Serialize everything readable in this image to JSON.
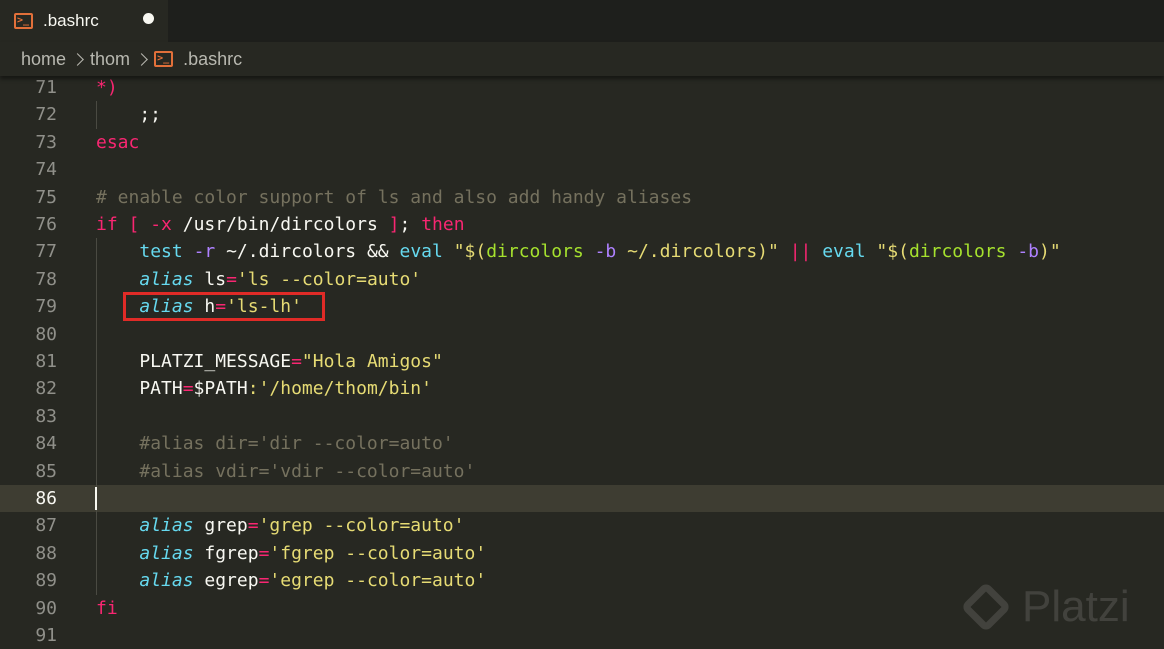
{
  "tab": {
    "title": ".bashrc",
    "modified": true
  },
  "breadcrumb": [
    "home",
    "thom",
    ".bashrc"
  ],
  "editor": {
    "current_line": 86,
    "lines": [
      {
        "n": 71,
        "tokens": [
          [
            "k",
            "*)"
          ]
        ]
      },
      {
        "n": 72,
        "tokens": [
          [
            "w",
            "    ;;"
          ]
        ]
      },
      {
        "n": 73,
        "tokens": [
          [
            "k",
            "esac"
          ]
        ]
      },
      {
        "n": 74,
        "tokens": []
      },
      {
        "n": 75,
        "tokens": [
          [
            "c",
            "# enable color support of ls and also add handy aliases"
          ]
        ]
      },
      {
        "n": 76,
        "tokens": [
          [
            "k",
            "if"
          ],
          [
            "w",
            " "
          ],
          [
            "k",
            "["
          ],
          [
            "w",
            " "
          ],
          [
            "k",
            "-x"
          ],
          [
            "w",
            " /usr/bin/dircolors "
          ],
          [
            "k",
            "]"
          ],
          [
            "w",
            "; "
          ],
          [
            "k",
            "then"
          ]
        ]
      },
      {
        "n": 77,
        "tokens": [
          [
            "w",
            "    "
          ],
          [
            "b",
            "test"
          ],
          [
            "w",
            " "
          ],
          [
            "p",
            "-r"
          ],
          [
            "w",
            " ~/.dircolors && "
          ],
          [
            "b",
            "eval"
          ],
          [
            "w",
            " "
          ],
          [
            "s",
            "\"$("
          ],
          [
            "g",
            "dircolors"
          ],
          [
            "s",
            " "
          ],
          [
            "p",
            "-b"
          ],
          [
            "s",
            " ~/.dircolors)\""
          ],
          [
            "w",
            " "
          ],
          [
            "k",
            "||"
          ],
          [
            "w",
            " "
          ],
          [
            "b",
            "eval"
          ],
          [
            "w",
            " "
          ],
          [
            "s",
            "\"$("
          ],
          [
            "g",
            "dircolors"
          ],
          [
            "s",
            " "
          ],
          [
            "p",
            "-b"
          ],
          [
            "s",
            ")\""
          ]
        ]
      },
      {
        "n": 78,
        "tokens": [
          [
            "w",
            "    "
          ],
          [
            "i",
            "alias"
          ],
          [
            "w",
            " ls"
          ],
          [
            "k",
            "="
          ],
          [
            "s",
            "'ls --color=auto'"
          ]
        ]
      },
      {
        "n": 79,
        "tokens": [
          [
            "w",
            "    "
          ],
          [
            "i",
            "alias"
          ],
          [
            "w",
            " h"
          ],
          [
            "k",
            "="
          ],
          [
            "s",
            "'ls-lh'"
          ]
        ]
      },
      {
        "n": 80,
        "tokens": []
      },
      {
        "n": 81,
        "tokens": [
          [
            "w",
            "    PLATZI_MESSAGE"
          ],
          [
            "k",
            "="
          ],
          [
            "s",
            "\"Hola Amigos\""
          ]
        ]
      },
      {
        "n": 82,
        "tokens": [
          [
            "w",
            "    PATH"
          ],
          [
            "k",
            "="
          ],
          [
            "w",
            "$PATH"
          ],
          [
            "s",
            ":'/home/thom/bin'"
          ]
        ]
      },
      {
        "n": 83,
        "tokens": []
      },
      {
        "n": 84,
        "tokens": [
          [
            "w",
            "    "
          ],
          [
            "c",
            "#alias dir='dir --color=auto'"
          ]
        ]
      },
      {
        "n": 85,
        "tokens": [
          [
            "w",
            "    "
          ],
          [
            "c",
            "#alias vdir='vdir --color=auto'"
          ]
        ]
      },
      {
        "n": 86,
        "tokens": []
      },
      {
        "n": 87,
        "tokens": [
          [
            "w",
            "    "
          ],
          [
            "i",
            "alias"
          ],
          [
            "w",
            " grep"
          ],
          [
            "k",
            "="
          ],
          [
            "s",
            "'grep --color=auto'"
          ]
        ]
      },
      {
        "n": 88,
        "tokens": [
          [
            "w",
            "    "
          ],
          [
            "i",
            "alias"
          ],
          [
            "w",
            " fgrep"
          ],
          [
            "k",
            "="
          ],
          [
            "s",
            "'fgrep --color=auto'"
          ]
        ]
      },
      {
        "n": 89,
        "tokens": [
          [
            "w",
            "    "
          ],
          [
            "i",
            "alias"
          ],
          [
            "w",
            " egrep"
          ],
          [
            "k",
            "="
          ],
          [
            "s",
            "'egrep --color=auto'"
          ]
        ]
      },
      {
        "n": 90,
        "tokens": [
          [
            "k",
            "fi"
          ]
        ]
      },
      {
        "n": 91,
        "tokens": []
      }
    ]
  },
  "watermark": {
    "text": "Platzi"
  },
  "colors": {
    "keyword": "#f92672",
    "comment": "#75715e",
    "string": "#e6db74",
    "builtin": "#66d9ef",
    "function": "#a6e22e",
    "number": "#ae81ff",
    "highlight_box": "#e02b27"
  }
}
